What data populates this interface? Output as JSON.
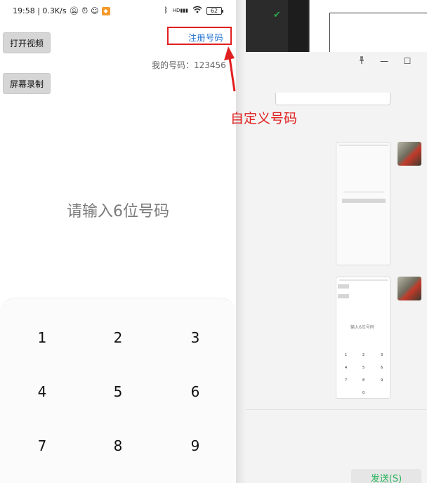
{
  "status_bar": {
    "time_speed": "19:58 | 0.3K/s",
    "network_badge": "HD",
    "battery": "62"
  },
  "phone": {
    "open_video_label": "打开视频",
    "screen_record_label": "屏幕录制",
    "register_label": "注册号码",
    "my_number_label": "我的号码：123456",
    "prompt": "请输入6位号码",
    "keypad": [
      "1",
      "2",
      "3",
      "4",
      "5",
      "6",
      "7",
      "8",
      "9"
    ]
  },
  "annotation": {
    "text": "自定义号码",
    "color": "#e02020"
  },
  "desktop": {
    "send_label": "发送(S)",
    "thumb_prompt": "输入6位号码",
    "thumb_keys": [
      "1",
      "2",
      "3",
      "4",
      "5",
      "6",
      "7",
      "8",
      "9",
      "0"
    ]
  },
  "colors": {
    "accent_link": "#1f6fd0",
    "send_text": "#27b35a",
    "check": "#2ea84f"
  }
}
